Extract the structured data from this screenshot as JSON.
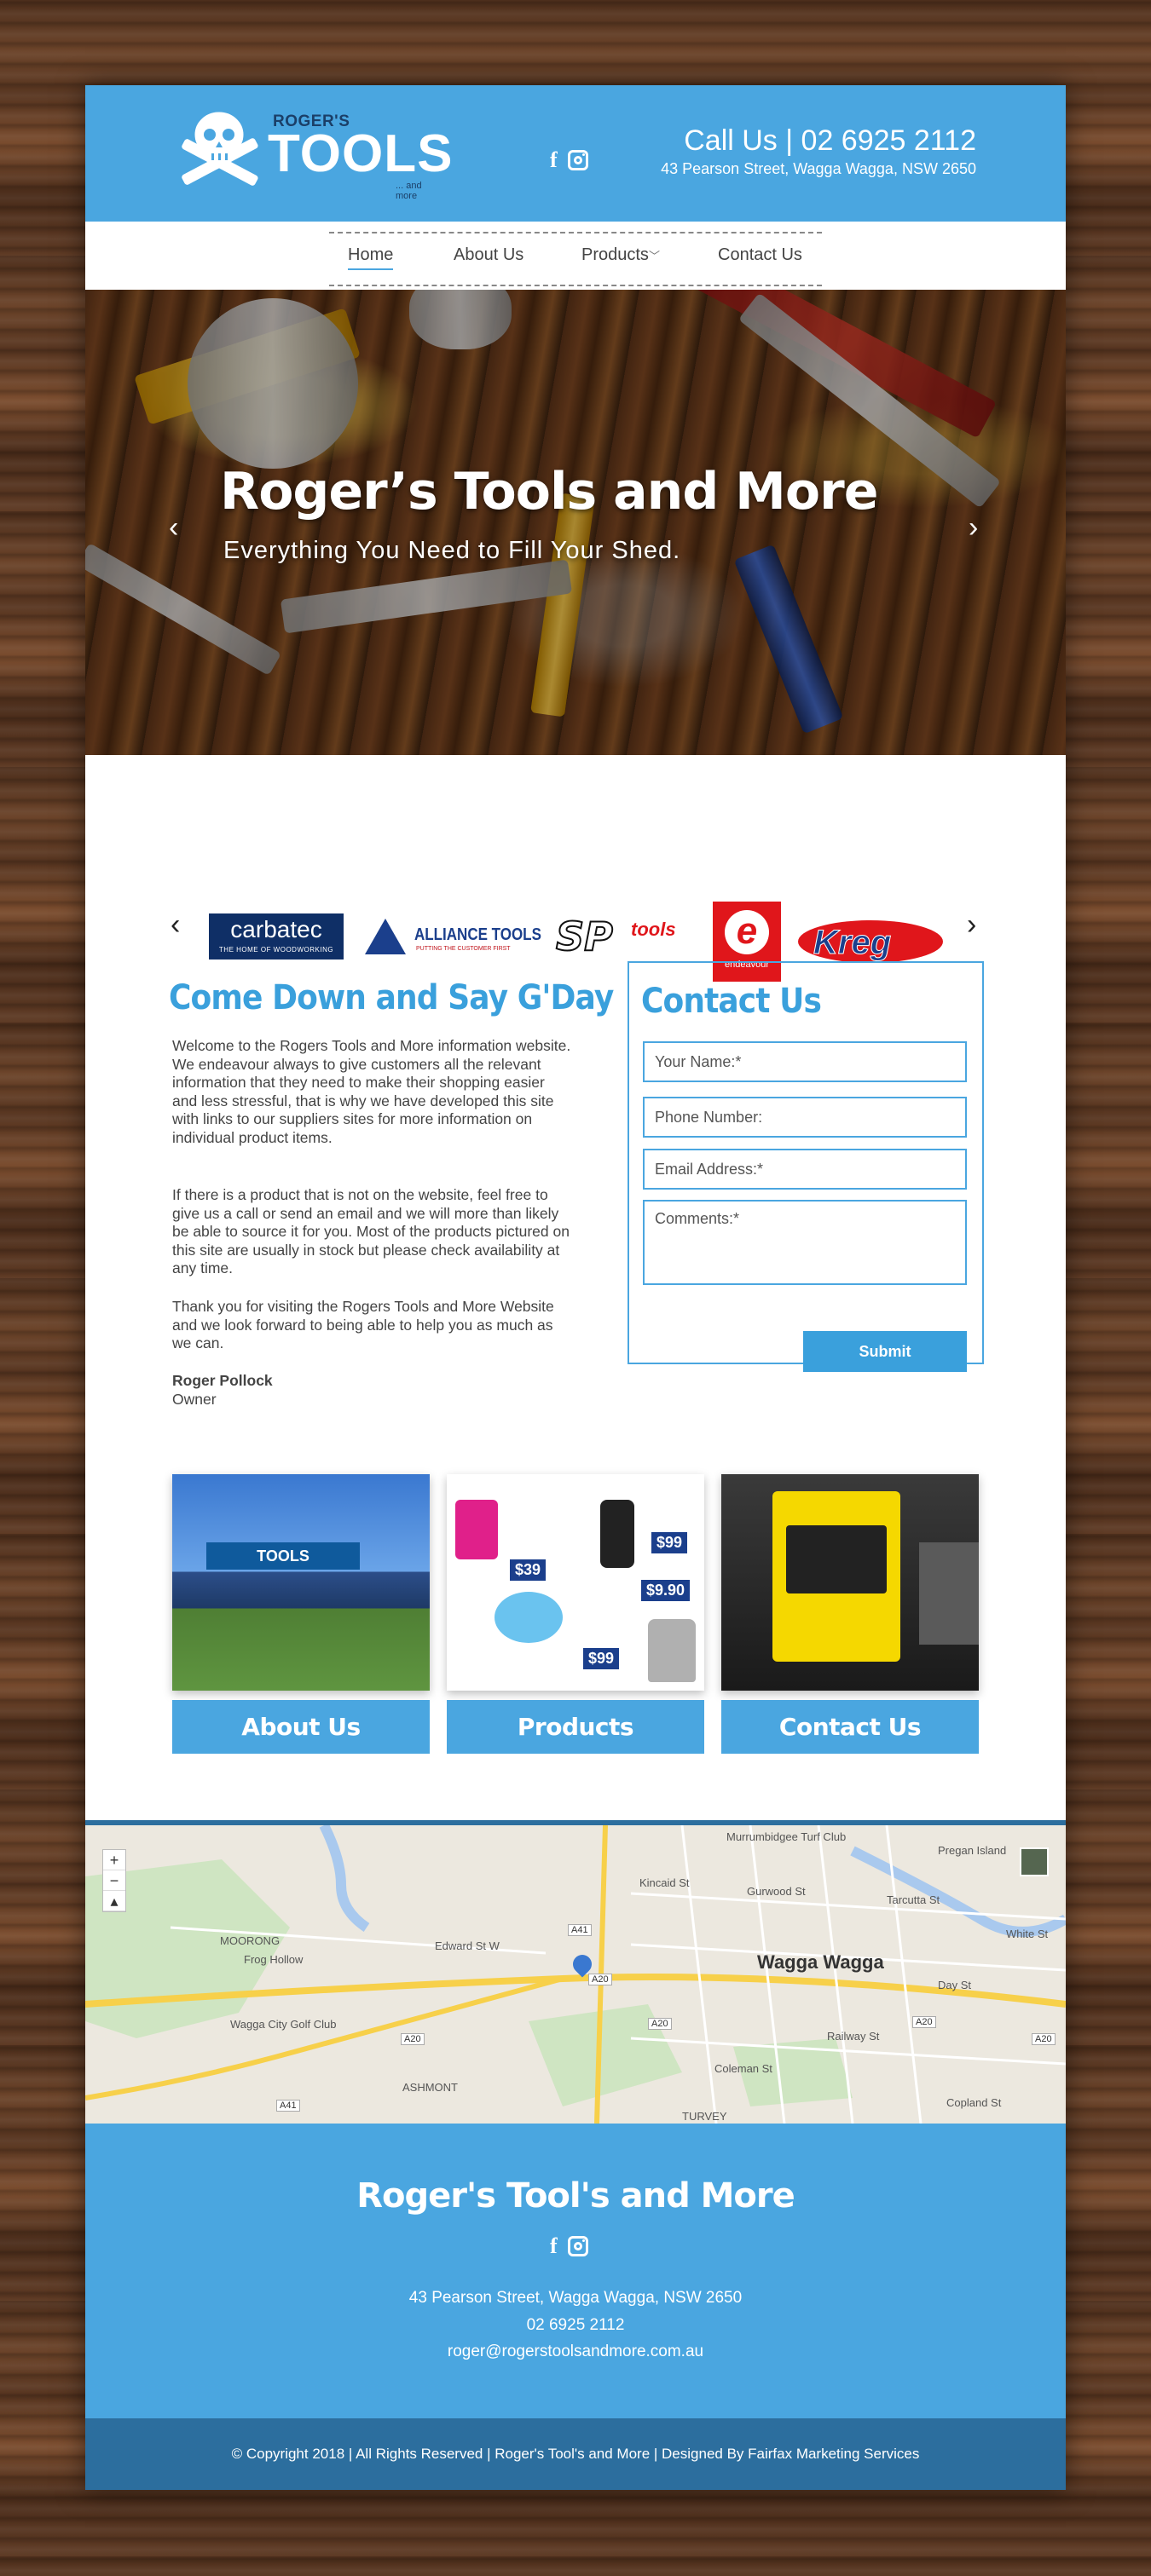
{
  "header": {
    "brand_small": "ROGER'S",
    "brand_big": "TOOLS",
    "brand_sub": "... and more",
    "call": "Call Us | 02 6925 2112",
    "address": "43 Pearson Street, Wagga Wagga, NSW 2650",
    "social": [
      "facebook-icon",
      "instagram-icon"
    ]
  },
  "nav": {
    "items": [
      {
        "label": "Home",
        "active": true
      },
      {
        "label": "About Us"
      },
      {
        "label": "Products"
      },
      {
        "label": "Contact Us"
      }
    ]
  },
  "hero": {
    "title": "Roger’s Tools and More",
    "subtitle": "Everything You Need to Fill Your Shed."
  },
  "brands": {
    "carbatec": "carbatec",
    "carbatec_sub": "THE HOME OF WOODWORKING",
    "alliance": "ALLIANCE TOOLS",
    "alliance_sub": "PUTTING THE CUSTOMER FIRST",
    "sp": "SP",
    "sp_word": "tools",
    "endeavour_letter": "e",
    "endeavour": "endeavour",
    "kreg": "Kreg"
  },
  "intro": {
    "title": "Come Down and Say G'Day",
    "p1": "Welcome to the Rogers Tools and More information website. We endeavour always to give customers all the relevant information that they need to make their shopping easier and less stressful, that is why we have developed this site with links to our suppliers sites for more information on individual product items.",
    "p2": "If there is a product that is not on the website, feel free to give us a call or send an email and we will more than likely be able to source it for you. Most of the products pictured on this site are usually in stock but please check availability at any time.",
    "p3": "Thank you for visiting the Rogers Tools and More Website and we look forward to being able to help you as much as we can.",
    "signer": "Roger Pollock",
    "signer_role": "Owner"
  },
  "contact": {
    "title": "Contact Us",
    "name_placeholder": "Your Name:*",
    "phone_placeholder": "Phone Number:",
    "email_placeholder": "Email Address:*",
    "comments_placeholder": "Comments:*",
    "submit": "Submit"
  },
  "cards": [
    {
      "label": "About Us",
      "image_text": "TOOLS"
    },
    {
      "label": "Products",
      "prices": [
        "$39",
        "$99",
        "$9.90",
        "$99"
      ]
    },
    {
      "label": "Contact Us"
    }
  ],
  "map": {
    "city": "Wagga Wagga",
    "labels": [
      "MOORONG",
      "Frog Hollow",
      "Edward St W",
      "Wagga City Golf Club",
      "ASHMONT",
      "Pregan Island",
      "Murrumbidgee Turf Club",
      "Gurwood St",
      "Kincaid St",
      "Railway St",
      "Coleman St",
      "TURVEY",
      "Copland St",
      "Day St",
      "White St",
      "Tarcutta St"
    ],
    "roads": [
      "A20",
      "A20",
      "A20",
      "A20",
      "A41",
      "A41",
      "A20"
    ],
    "zoom_controls": [
      "+",
      "−",
      "▴"
    ]
  },
  "footer": {
    "title": "Roger's Tool's and More",
    "address": "43 Pearson Street, Wagga Wagga, NSW 2650",
    "phone": "02 6925 2112",
    "email": "roger@rogerstoolsandmore.com.au",
    "copyright": "© Copyright 2018 | All Rights Reserved | Roger's Tool's and More | Designed By Fairfax Marketing Services"
  },
  "colors": {
    "primary": "#4aa6e0",
    "dark_bar": "#2c6e9e",
    "heading": "#3aa0dc"
  }
}
